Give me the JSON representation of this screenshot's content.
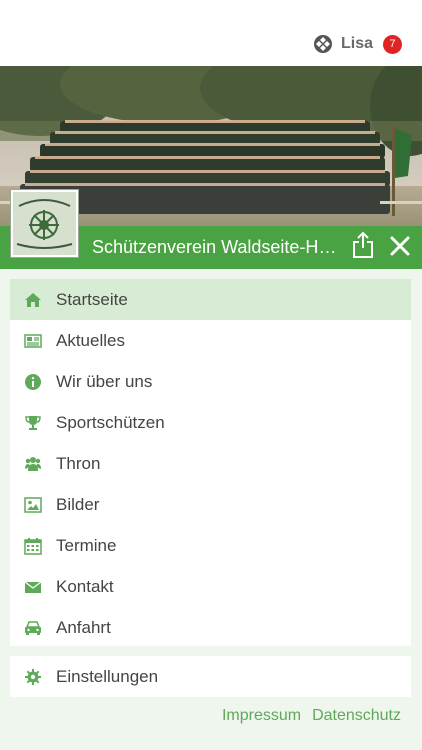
{
  "user": {
    "name": "Lisa",
    "notification_count": "7"
  },
  "club": {
    "title": "Schützenverein Waldseite-Ha...",
    "logo_lettering": "Schützenverein Waldseite-Hegenland e.V."
  },
  "menu": {
    "items": [
      {
        "label": "Startseite",
        "icon": "home-icon",
        "active": true
      },
      {
        "label": "Aktuelles",
        "icon": "newspaper-icon",
        "active": false
      },
      {
        "label": "Wir über uns",
        "icon": "info-icon",
        "active": false
      },
      {
        "label": "Sportschützen",
        "icon": "trophy-icon",
        "active": false
      },
      {
        "label": "Thron",
        "icon": "users-icon",
        "active": false
      },
      {
        "label": "Bilder",
        "icon": "image-icon",
        "active": false
      },
      {
        "label": "Termine",
        "icon": "calendar-icon",
        "active": false
      },
      {
        "label": "Kontakt",
        "icon": "envelope-icon",
        "active": false
      },
      {
        "label": "Anfahrt",
        "icon": "car-icon",
        "active": false
      }
    ],
    "settings": {
      "label": "Einstellungen",
      "icon": "gear-icon"
    }
  },
  "footer": {
    "impressum": "Impressum",
    "datenschutz": "Datenschutz"
  },
  "colors": {
    "accent": "#49a342",
    "icon": "#5fa95a",
    "active_bg": "#d8ebd4",
    "page_bg": "#eef6ee",
    "badge": "#e02424"
  }
}
